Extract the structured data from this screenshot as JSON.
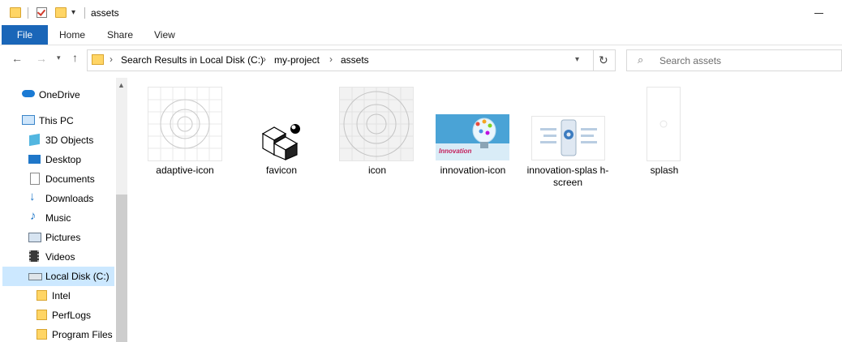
{
  "window": {
    "title": "assets"
  },
  "ribbon": {
    "tabs": [
      "File",
      "Home",
      "Share",
      "View"
    ]
  },
  "address": {
    "breadcrumbs": [
      "Search Results in Local Disk (C:)",
      "my-project",
      "assets"
    ]
  },
  "search": {
    "placeholder": "Search assets"
  },
  "sidebar": {
    "items": [
      {
        "label": "OneDrive",
        "icon": "cloud-icon"
      },
      {
        "label": "This PC",
        "icon": "computer-icon"
      },
      {
        "label": "3D Objects",
        "icon": "cube-icon"
      },
      {
        "label": "Desktop",
        "icon": "desktop-icon"
      },
      {
        "label": "Documents",
        "icon": "document-icon"
      },
      {
        "label": "Downloads",
        "icon": "download-icon"
      },
      {
        "label": "Music",
        "icon": "music-icon"
      },
      {
        "label": "Pictures",
        "icon": "picture-icon"
      },
      {
        "label": "Videos",
        "icon": "video-icon"
      },
      {
        "label": "Local Disk (C:)",
        "icon": "drive-icon",
        "selected": true
      },
      {
        "label": "Intel",
        "icon": "folder-icon"
      },
      {
        "label": "PerfLogs",
        "icon": "folder-icon"
      },
      {
        "label": "Program Files",
        "icon": "folder-icon"
      }
    ]
  },
  "files": [
    {
      "name": "adaptive-icon",
      "thumb": "target-grid"
    },
    {
      "name": "favicon",
      "thumb": "cube"
    },
    {
      "name": "icon",
      "thumb": "target-grid"
    },
    {
      "name": "innovation-icon",
      "thumb": "innovation"
    },
    {
      "name": "innovation-splas h-screen",
      "thumb": "splash-phone"
    },
    {
      "name": "splash",
      "thumb": "blank"
    }
  ],
  "thumb_text": {
    "innovation": "Innovation"
  },
  "colors": {
    "accent": "#1a66b8",
    "selected": "#cce8ff",
    "folder": "#ffd565"
  }
}
